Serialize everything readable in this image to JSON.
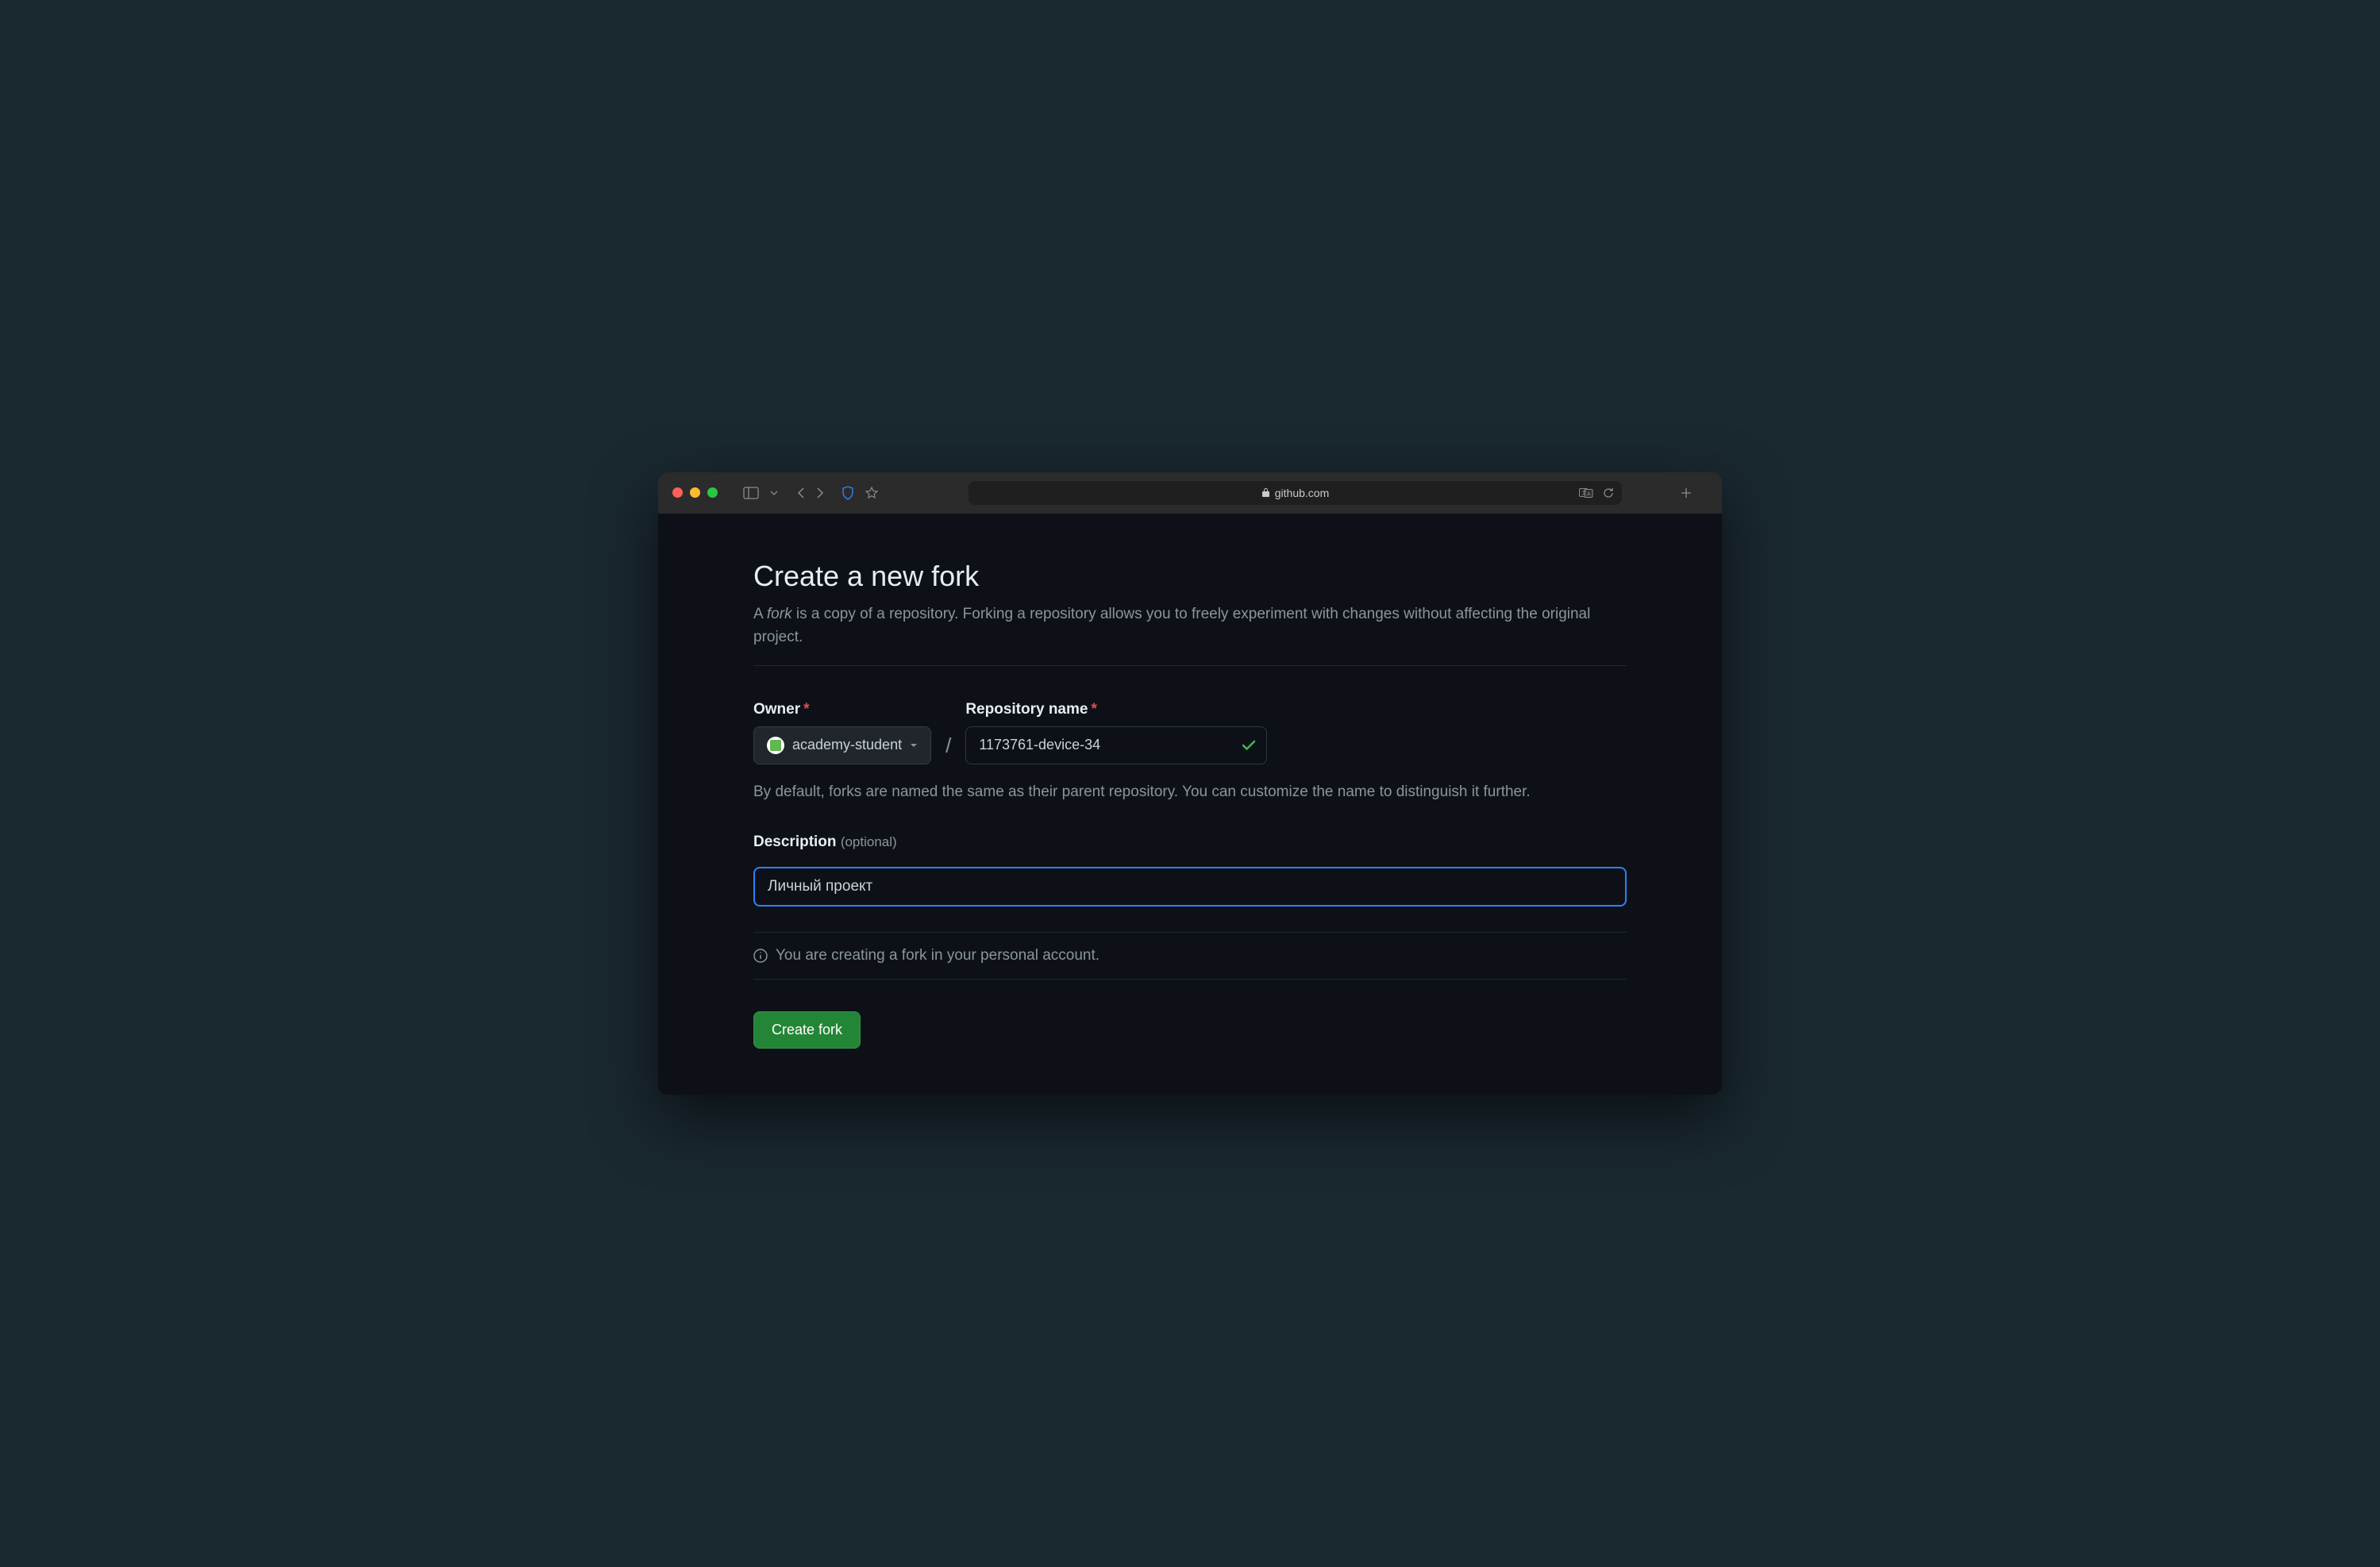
{
  "browser": {
    "domain": "github.com"
  },
  "page": {
    "title": "Create a new fork",
    "lead_prefix": "A ",
    "lead_em": "fork",
    "lead_rest": " is a copy of a repository. Forking a repository allows you to freely experiment with changes without affecting the original project."
  },
  "form": {
    "owner_label": "Owner",
    "owner_value": "academy-student",
    "repo_label": "Repository name",
    "repo_value": "1173761-device-34",
    "default_hint": "By default, forks are named the same as their parent repository. You can customize the name to distinguish it further.",
    "desc_label": "Description",
    "desc_optional": "(optional)",
    "desc_value": "Личный проект",
    "info_text": "You are creating a fork in your personal account.",
    "submit_label": "Create fork"
  }
}
